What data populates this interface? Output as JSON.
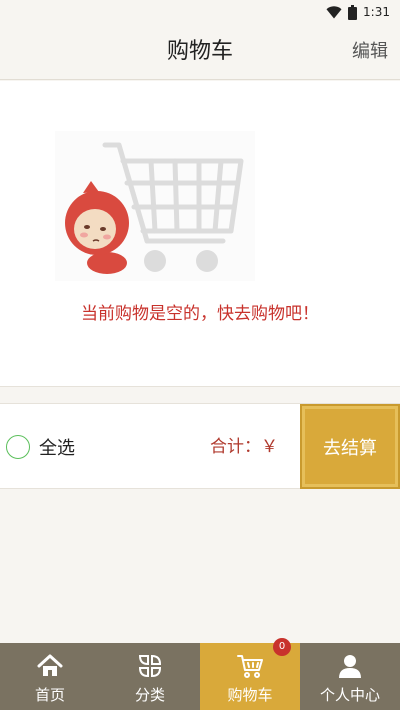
{
  "status_bar": {
    "time": "1:31",
    "icons": [
      "wifi-icon",
      "battery-icon"
    ]
  },
  "header": {
    "title": "购物车",
    "edit_label": "编辑"
  },
  "empty_state": {
    "illustration": "empty-cart-mascot",
    "message": "当前购物是空的，快去购物吧！"
  },
  "checkout_bar": {
    "select_all_label": "全选",
    "total_label": "合计：￥",
    "checkout_label": "去结算"
  },
  "tabbar": {
    "items": [
      {
        "label": "首页",
        "icon": "home-icon"
      },
      {
        "label": "分类",
        "icon": "category-icon"
      },
      {
        "label": "购物车",
        "icon": "cart-icon",
        "badge": "0",
        "active": true
      },
      {
        "label": "个人中心",
        "icon": "user-icon"
      }
    ]
  },
  "colors": {
    "accent": "#d9a93a",
    "tabbar_bg": "#7a7261",
    "empty_text": "#c8322c",
    "total_text": "#b03a2e",
    "radio": "#5bbf5b"
  }
}
